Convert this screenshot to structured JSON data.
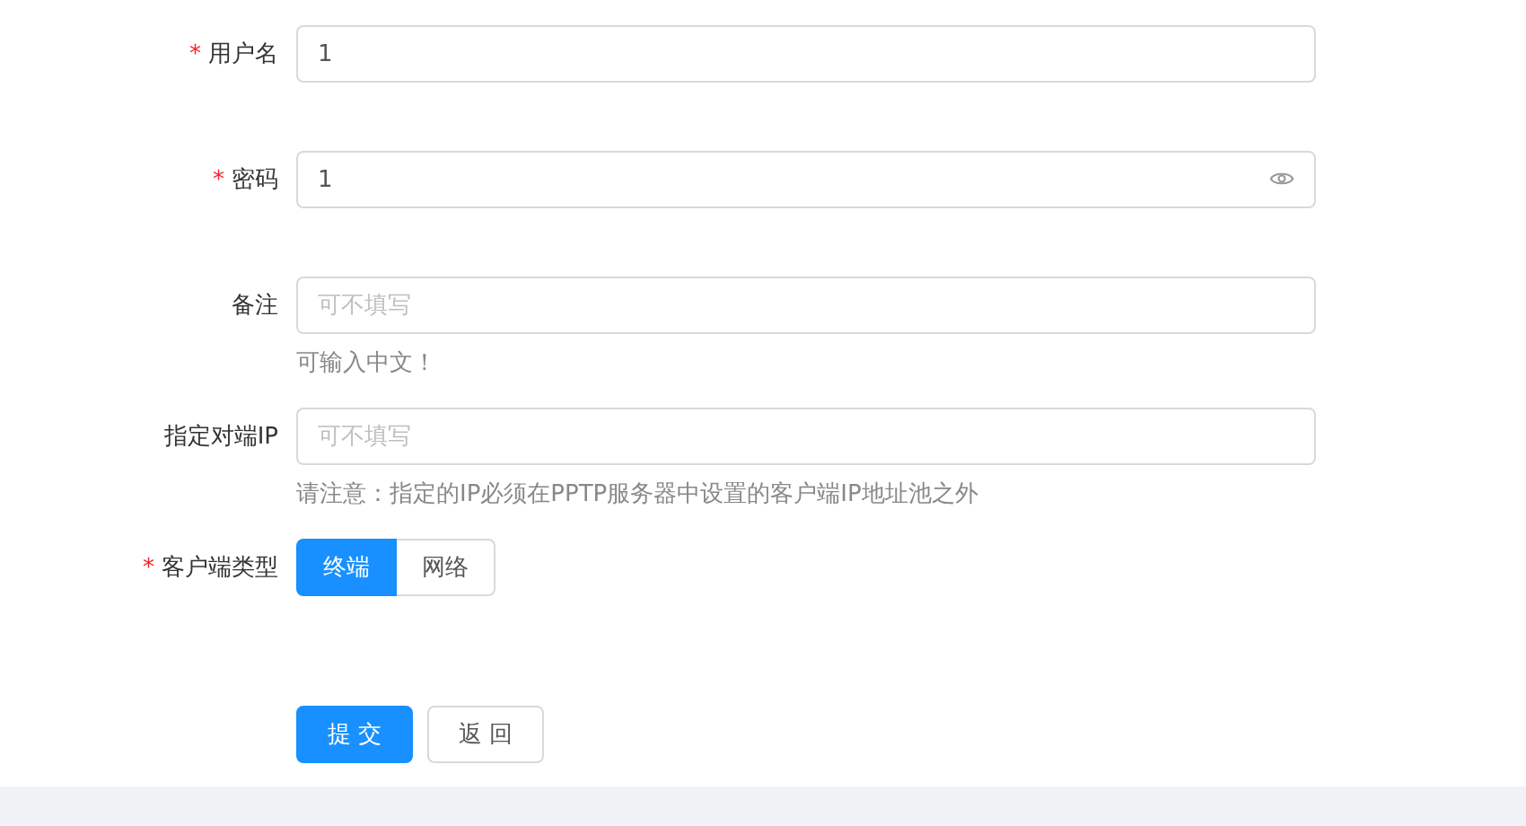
{
  "form": {
    "fields": [
      {
        "kind": "text",
        "required_mark": "*",
        "label": "用户名",
        "value": "1"
      },
      {
        "kind": "password",
        "required_mark": "*",
        "label": "密码",
        "value": "1"
      },
      {
        "kind": "text",
        "label": "备注",
        "placeholder": "可不填写",
        "hint": "可输入中文！"
      },
      {
        "kind": "text",
        "label": "指定对端IP",
        "placeholder": "可不填写",
        "hint": "请注意：指定的IP必须在PPTP服务器中设置的客户端IP地址池之外"
      },
      {
        "kind": "radio",
        "required_mark": "*",
        "label": "客户端类型",
        "options": [
          {
            "label": "终端",
            "selected": true
          },
          {
            "label": "网络",
            "selected": false
          }
        ]
      }
    ],
    "buttons": [
      {
        "label": "提 交",
        "primary": true
      },
      {
        "label": "返 回",
        "primary": false
      }
    ]
  }
}
